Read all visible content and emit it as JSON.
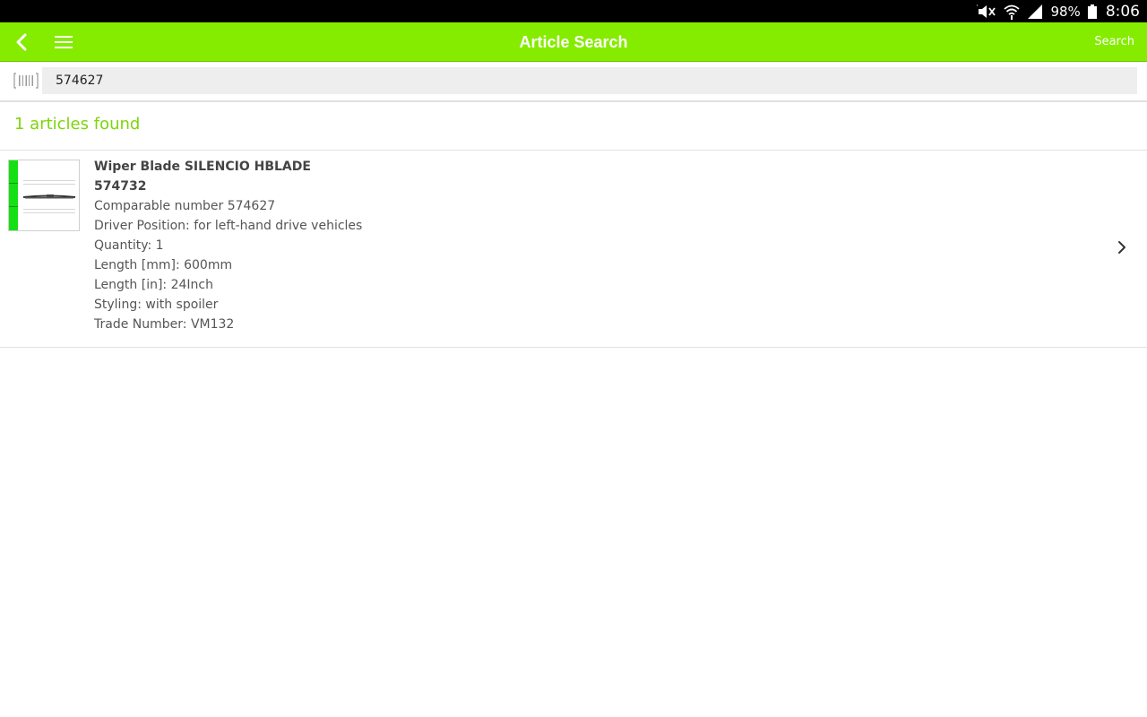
{
  "status_bar": {
    "battery_percent": "98%",
    "time": "8:06",
    "icons": [
      "mute-icon",
      "wifi-icon",
      "signal-icon",
      "battery-icon"
    ]
  },
  "app_bar": {
    "title": "Article Search",
    "search_label": "Search",
    "background_color": "#85ec00"
  },
  "search": {
    "value": "574627"
  },
  "results": {
    "count_label": "1 articles found",
    "accent_color": "#7ed40a",
    "items": [
      {
        "title": "Wiper Blade SILENCIO HBLADE",
        "number": "574732",
        "comparable": "Comparable number 574627",
        "driver_position": "Driver Position: for left-hand drive vehicles",
        "quantity": "Quantity: 1",
        "length_mm": "Length [mm]: 600mm",
        "length_in": "Length [in]: 24Inch",
        "styling": "Styling: with spoiler",
        "trade_number": "Trade Number: VM132",
        "stock_color": "#14e014"
      }
    ]
  }
}
